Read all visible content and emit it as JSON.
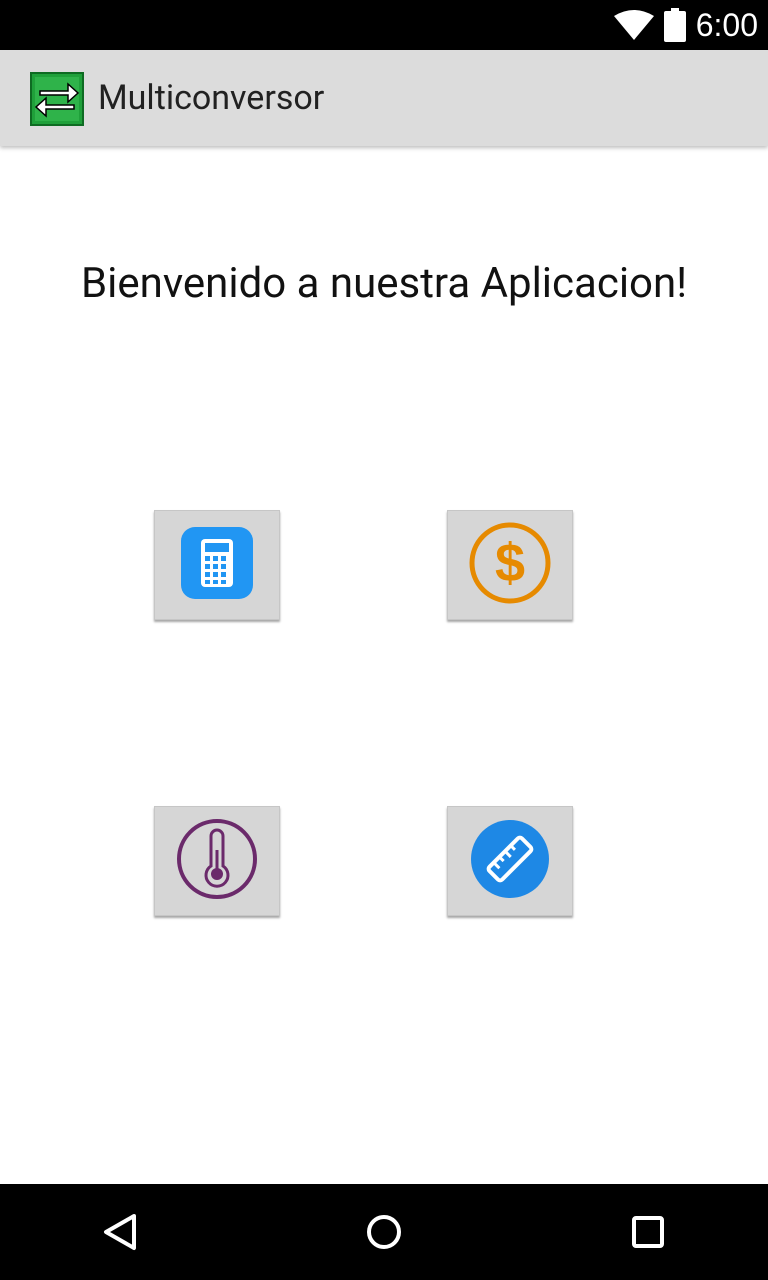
{
  "status_bar": {
    "time": "6:00",
    "icons": [
      "wifi-icon",
      "battery-icon"
    ]
  },
  "app_bar": {
    "app_icon": "multiconversor-logo-icon",
    "title": "Multiconversor"
  },
  "main": {
    "welcome_text": "Bienvenido a nuestra Aplicacion!",
    "buttons": [
      {
        "icon": "calculator-icon",
        "color": "#2196F3"
      },
      {
        "icon": "dollar-icon",
        "color": "#E68A00"
      },
      {
        "icon": "thermometer-icon",
        "color": "#6B2A6B"
      },
      {
        "icon": "ruler-icon",
        "color": "#1E88E5"
      }
    ]
  },
  "nav_bar": {
    "buttons": [
      "back-icon",
      "home-icon",
      "recent-apps-icon"
    ]
  }
}
